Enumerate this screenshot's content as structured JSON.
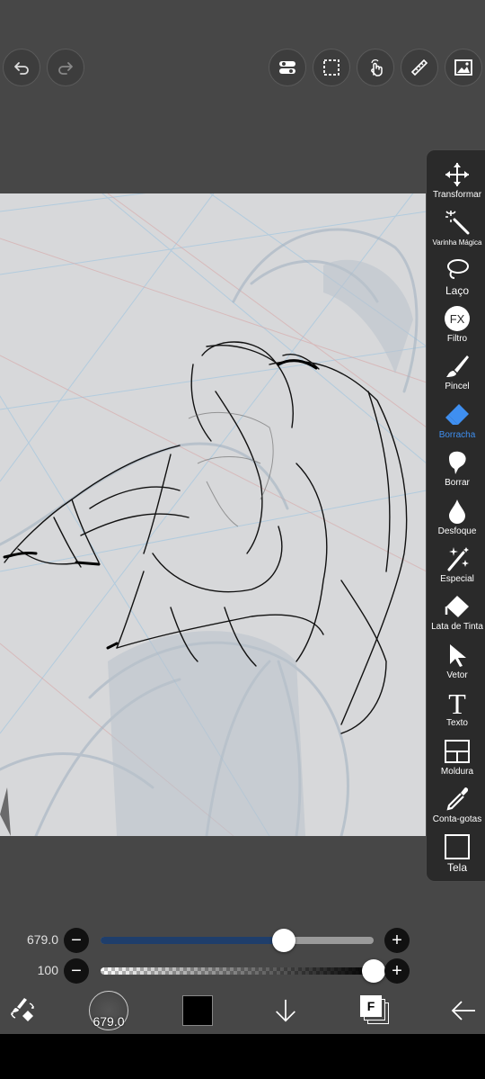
{
  "toolbar": {
    "undo_icon": "undo-icon",
    "redo_icon": "redo-icon",
    "right_icons": [
      "toggle-icon",
      "selection-icon",
      "gesture-icon",
      "ruler-icon",
      "image-icon"
    ]
  },
  "tools": [
    {
      "id": "transform",
      "label": "Transformar",
      "icon": "move-arrows-icon"
    },
    {
      "id": "magic-wand",
      "label": "Varinha Mágica",
      "icon": "magic-wand-icon"
    },
    {
      "id": "lasso",
      "label": "Laço",
      "icon": "lasso-icon"
    },
    {
      "id": "filter",
      "label": "Filtro",
      "icon": "fx-icon"
    },
    {
      "id": "brush",
      "label": "Pincel",
      "icon": "brush-icon"
    },
    {
      "id": "eraser",
      "label": "Borracha",
      "icon": "eraser-icon",
      "active": true
    },
    {
      "id": "smudge",
      "label": "Borrar",
      "icon": "smudge-icon"
    },
    {
      "id": "blur",
      "label": "Desfoque",
      "icon": "droplet-icon"
    },
    {
      "id": "special",
      "label": "Especial",
      "icon": "sparkle-icon"
    },
    {
      "id": "fill",
      "label": "Lata de Tinta",
      "icon": "paint-bucket-icon"
    },
    {
      "id": "vector",
      "label": "Vetor",
      "icon": "cursor-arrow-icon"
    },
    {
      "id": "text",
      "label": "Texto",
      "icon": "text-icon"
    },
    {
      "id": "frame",
      "label": "Moldura",
      "icon": "frame-icon"
    },
    {
      "id": "eyedropper",
      "label": "Conta-gotas",
      "icon": "eyedropper-icon"
    },
    {
      "id": "canvas",
      "label": "Tela",
      "icon": "canvas-icon"
    }
  ],
  "sliders": {
    "size": {
      "value_text": "679.0",
      "fraction": 0.67,
      "minus": "−",
      "plus": "+"
    },
    "opacity": {
      "value_text": "100",
      "fraction": 1.0,
      "minus": "−",
      "plus": "+"
    }
  },
  "bottom": {
    "brush_size_text": "679.0",
    "color": "#000000",
    "layer_letter": "F",
    "icons": [
      "swap-tool-icon",
      "brush-preview-icon",
      "color-swatch-icon",
      "down-arrow-icon",
      "layers-icon",
      "back-arrow-icon"
    ]
  },
  "colors": {
    "accent": "#3f8ff0",
    "slider_fill": "#1f3e6b"
  }
}
